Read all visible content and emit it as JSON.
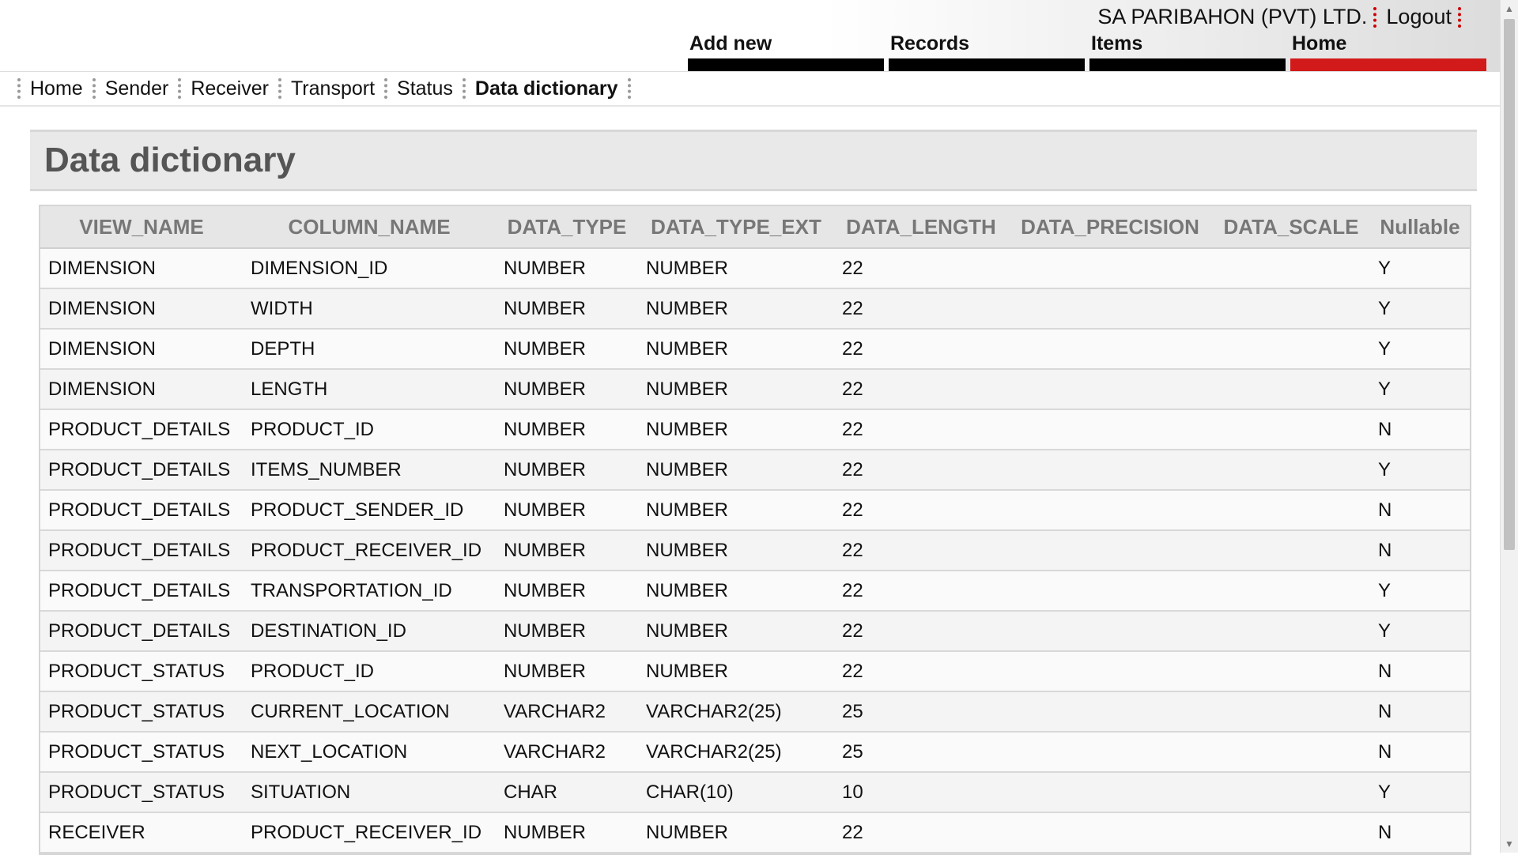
{
  "header": {
    "company": "SA PARIBAHON (PVT) LTD.",
    "logout": "Logout",
    "top_nav": [
      {
        "label": "Add new",
        "active": false
      },
      {
        "label": "Records",
        "active": false
      },
      {
        "label": "Items",
        "active": false
      },
      {
        "label": "Home",
        "active": true
      }
    ],
    "accent_color": "#d21a1a"
  },
  "sub_nav": {
    "items": [
      "Home",
      "Sender",
      "Receiver",
      "Transport",
      "Status",
      "Data dictionary"
    ],
    "current": "Data dictionary"
  },
  "page": {
    "title": "Data dictionary"
  },
  "table": {
    "columns": [
      "VIEW_NAME",
      "COLUMN_NAME",
      "DATA_TYPE",
      "DATA_TYPE_EXT",
      "DATA_LENGTH",
      "DATA_PRECISION",
      "DATA_SCALE",
      "Nullable"
    ],
    "rows": [
      [
        "DIMENSION",
        "DIMENSION_ID",
        "NUMBER",
        "NUMBER",
        "22",
        "",
        "",
        "Y"
      ],
      [
        "DIMENSION",
        "WIDTH",
        "NUMBER",
        "NUMBER",
        "22",
        "",
        "",
        "Y"
      ],
      [
        "DIMENSION",
        "DEPTH",
        "NUMBER",
        "NUMBER",
        "22",
        "",
        "",
        "Y"
      ],
      [
        "DIMENSION",
        "LENGTH",
        "NUMBER",
        "NUMBER",
        "22",
        "",
        "",
        "Y"
      ],
      [
        "PRODUCT_DETAILS",
        "PRODUCT_ID",
        "NUMBER",
        "NUMBER",
        "22",
        "",
        "",
        "N"
      ],
      [
        "PRODUCT_DETAILS",
        "ITEMS_NUMBER",
        "NUMBER",
        "NUMBER",
        "22",
        "",
        "",
        "Y"
      ],
      [
        "PRODUCT_DETAILS",
        "PRODUCT_SENDER_ID",
        "NUMBER",
        "NUMBER",
        "22",
        "",
        "",
        "N"
      ],
      [
        "PRODUCT_DETAILS",
        "PRODUCT_RECEIVER_ID",
        "NUMBER",
        "NUMBER",
        "22",
        "",
        "",
        "N"
      ],
      [
        "PRODUCT_DETAILS",
        "TRANSPORTATION_ID",
        "NUMBER",
        "NUMBER",
        "22",
        "",
        "",
        "Y"
      ],
      [
        "PRODUCT_DETAILS",
        "DESTINATION_ID",
        "NUMBER",
        "NUMBER",
        "22",
        "",
        "",
        "Y"
      ],
      [
        "PRODUCT_STATUS",
        "PRODUCT_ID",
        "NUMBER",
        "NUMBER",
        "22",
        "",
        "",
        "N"
      ],
      [
        "PRODUCT_STATUS",
        "CURRENT_LOCATION",
        "VARCHAR2",
        "VARCHAR2(25)",
        "25",
        "",
        "",
        "N"
      ],
      [
        "PRODUCT_STATUS",
        "NEXT_LOCATION",
        "VARCHAR2",
        "VARCHAR2(25)",
        "25",
        "",
        "",
        "N"
      ],
      [
        "PRODUCT_STATUS",
        "SITUATION",
        "CHAR",
        "CHAR(10)",
        "10",
        "",
        "",
        "Y"
      ],
      [
        "RECEIVER",
        "PRODUCT_RECEIVER_ID",
        "NUMBER",
        "NUMBER",
        "22",
        "",
        "",
        "N"
      ]
    ]
  }
}
